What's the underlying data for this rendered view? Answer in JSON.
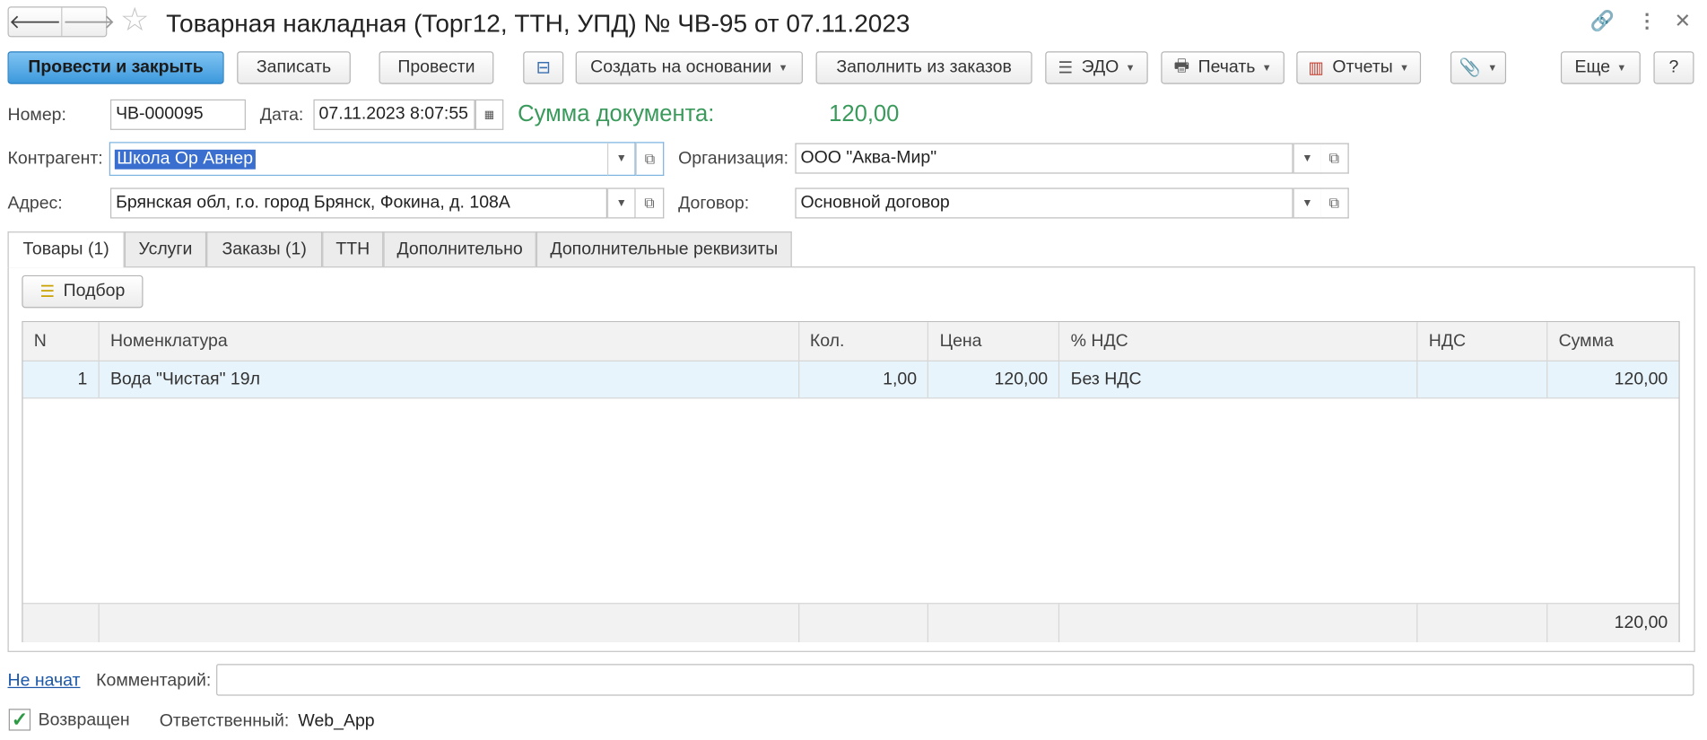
{
  "window": {
    "title": "Товарная накладная (Торг12, ТТН, УПД) № ЧВ-95 от 07.11.2023"
  },
  "toolbar": {
    "post_close": "Провести и закрыть",
    "save": "Записать",
    "post": "Провести",
    "create_based": "Создать на основании",
    "fill_orders": "Заполнить из заказов",
    "edo": "ЭДО",
    "print": "Печать",
    "reports": "Отчеты",
    "more": "Еще",
    "help": "?"
  },
  "form": {
    "number_label": "Номер:",
    "number_value": "ЧВ-000095",
    "date_label": "Дата:",
    "date_value": "07.11.2023  8:07:55",
    "sum_label": "Сумма документа:",
    "sum_value": "120,00",
    "counterparty_label": "Контрагент:",
    "counterparty_value": "Школа Ор Авнер",
    "organization_label": "Организация:",
    "organization_value": "ООО \"Аква-Мир\"",
    "address_label": "Адрес:",
    "address_value": "Брянская обл, г.о. город Брянск, Фокина, д. 108А",
    "contract_label": "Договор:",
    "contract_value": "Основной договор"
  },
  "tabs": [
    {
      "label": "Товары (1)",
      "active": true
    },
    {
      "label": "Услуги",
      "active": false
    },
    {
      "label": "Заказы (1)",
      "active": false
    },
    {
      "label": "ТТН",
      "active": false
    },
    {
      "label": "Дополнительно",
      "active": false
    },
    {
      "label": "Дополнительные реквизиты",
      "active": false
    }
  ],
  "goods": {
    "pick_button": "Подбор",
    "columns": [
      "N",
      "Номенклатура",
      "Кол.",
      "Цена",
      "% НДС",
      "НДС",
      "Сумма"
    ],
    "rows": [
      {
        "n": "1",
        "item": "Вода \"Чистая\" 19л",
        "qty": "1,00",
        "price": "120,00",
        "vat_rate": "Без НДС",
        "vat": "",
        "sum": "120,00"
      }
    ],
    "total_sum": "120,00"
  },
  "footer": {
    "status_link": "Не начат",
    "comment_label": "Комментарий:",
    "comment_value": "",
    "returned_label": "Возвращен",
    "returned_checked": true,
    "responsible_label": "Ответственный:",
    "responsible_value": "Web_App"
  },
  "colors": {
    "primary_button": "#3c99dc",
    "sum_green": "#3a9a5b",
    "selection": "#3a6fcf",
    "row_highlight": "#e8f4fb",
    "link": "#1c57a8"
  }
}
